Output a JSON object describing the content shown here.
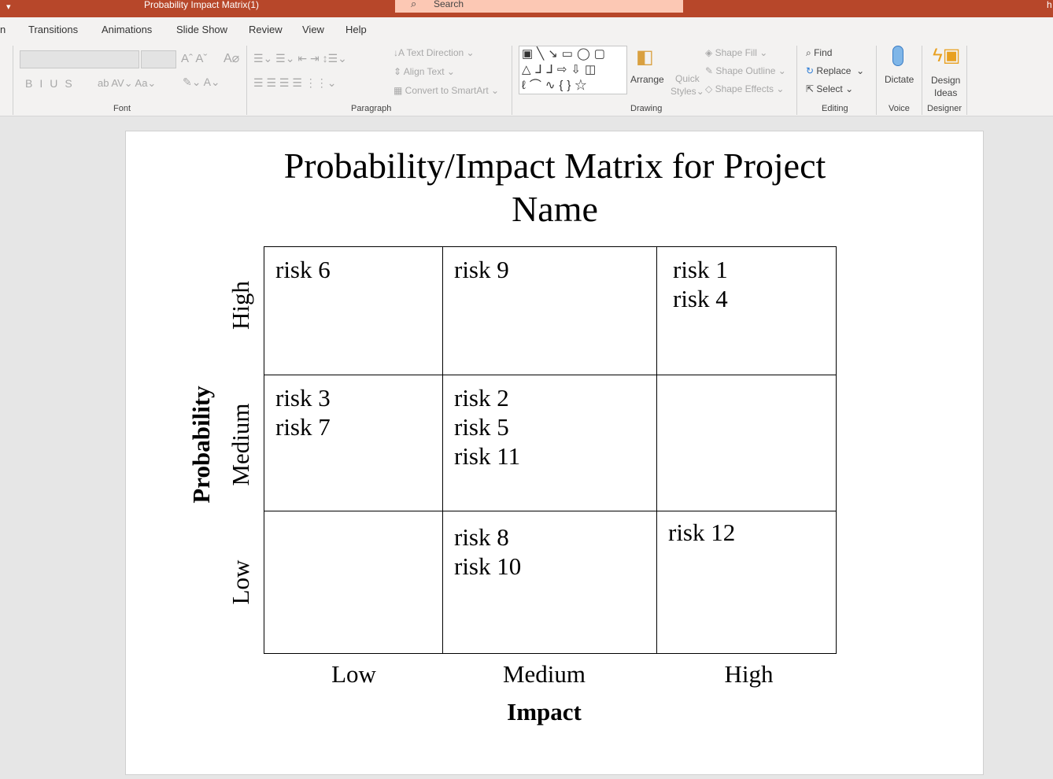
{
  "window": {
    "title": "Probability Impact Matrix(1)",
    "search_placeholder": "Search",
    "right_initial": "h"
  },
  "tabs": [
    "n",
    "Transitions",
    "Animations",
    "Slide Show",
    "Review",
    "View",
    "Help"
  ],
  "ribbon": {
    "font_group": "Font",
    "paragraph_group": "Paragraph",
    "drawing_group": "Drawing",
    "editing_group": "Editing",
    "voice_group": "Voice",
    "designer_group": "Designer",
    "text_direction": "Text Direction",
    "align_text": "Align Text",
    "convert_smartart": "Convert to SmartArt",
    "arrange": "Arrange",
    "quick_styles_1": "Quick",
    "quick_styles_2": "Styles",
    "shape_fill": "Shape Fill",
    "shape_outline": "Shape Outline",
    "shape_effects": "Shape Effects",
    "find": "Find",
    "replace": "Replace",
    "select": "Select",
    "dictate": "Dictate",
    "design_ideas_1": "Design",
    "design_ideas_2": "Ideas"
  },
  "slide": {
    "title": "Probability/Impact Matrix for Project Name",
    "y_axis_label": "Probability",
    "x_axis_label": "Impact",
    "row_labels": [
      "High",
      "Medium",
      "Low"
    ],
    "col_labels": [
      "Low",
      "Medium",
      "High"
    ],
    "cells": [
      [
        [
          "risk 6"
        ],
        [
          "risk 9"
        ],
        [
          "risk 1",
          "risk 4"
        ]
      ],
      [
        [
          "risk 3",
          "risk 7"
        ],
        [
          "risk 2",
          "risk 5",
          "risk 11"
        ],
        []
      ],
      [
        [],
        [
          "risk 8",
          "risk 10"
        ],
        [
          "risk 12"
        ]
      ]
    ]
  }
}
